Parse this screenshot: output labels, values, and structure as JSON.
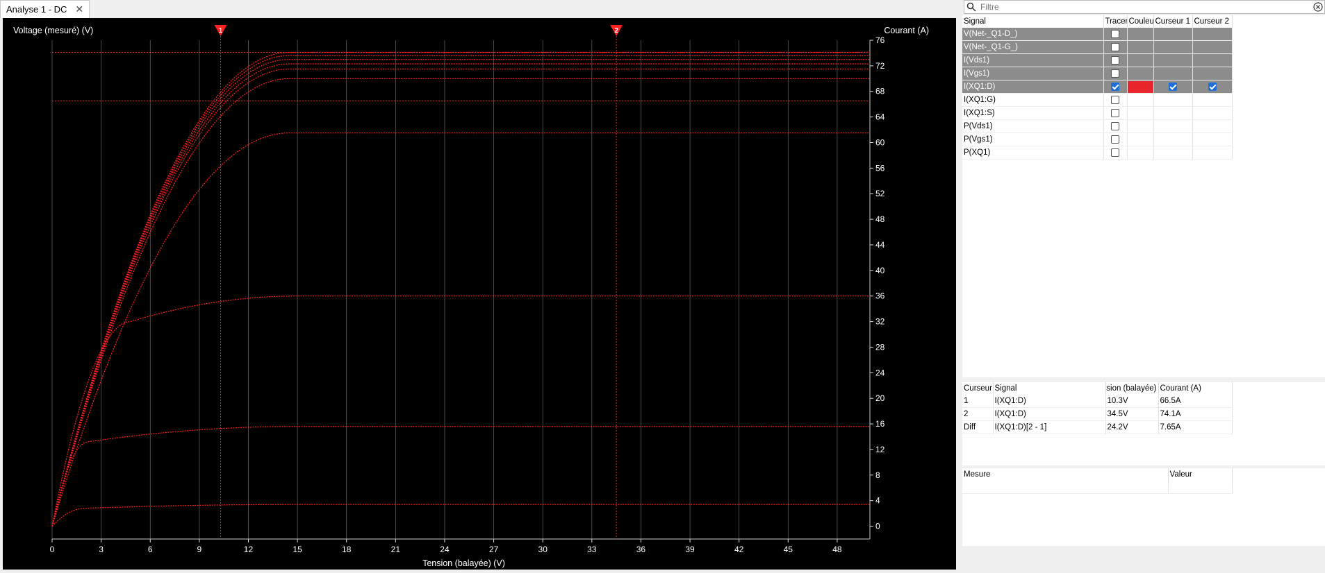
{
  "tab": {
    "title": "Analyse 1 - DC",
    "close": "✕"
  },
  "filter": {
    "placeholder": "Filtre"
  },
  "chart_data": {
    "type": "line",
    "xlabel": "Tension (balayée) (V)",
    "ylabel_left": "Voltage (mesuré) (V)",
    "ylabel_right": "Courant (A)",
    "xlim": [
      0,
      50
    ],
    "ylim": [
      -2,
      76
    ],
    "xticks": [
      0,
      3,
      6,
      9,
      12,
      15,
      18,
      21,
      24,
      27,
      30,
      33,
      36,
      39,
      42,
      45,
      48
    ],
    "yticks": [
      0,
      4,
      8,
      12,
      16,
      20,
      24,
      28,
      32,
      36,
      40,
      44,
      48,
      52,
      56,
      60,
      64,
      68,
      72,
      76
    ],
    "grid": true,
    "series_color": "#ff2020",
    "series": [
      {
        "sat_v": 2.0,
        "plateau": [
          2.8,
          3.4
        ]
      },
      {
        "sat_v": 2.2,
        "plateau": [
          13.2,
          15.6
        ]
      },
      {
        "sat_v": 4.8,
        "plateau": [
          32.0,
          36.0
        ]
      },
      {
        "sat_v": 14.5,
        "plateau": [
          61.5,
          61.5
        ]
      },
      {
        "sat_v": 14.5,
        "plateau": [
          70.0,
          70.0
        ]
      },
      {
        "sat_v": 14.5,
        "plateau": [
          71.5,
          71.5
        ]
      },
      {
        "sat_v": 14.5,
        "plateau": [
          72.3,
          72.3
        ]
      },
      {
        "sat_v": 14.5,
        "plateau": [
          73.0,
          73.0
        ]
      },
      {
        "sat_v": 14.5,
        "plateau": [
          73.6,
          73.6
        ]
      },
      {
        "sat_v": 14.5,
        "plateau": [
          74.1,
          74.1
        ]
      }
    ],
    "cursors": [
      {
        "label": "1",
        "x": 10.3,
        "y": 66.5
      },
      {
        "label": "2",
        "x": 34.5,
        "y": 74.1
      }
    ]
  },
  "signals": {
    "headers": [
      "Signal",
      "Tracer",
      "Couleur",
      "Curseur 1",
      "Curseur 2"
    ],
    "rows": [
      {
        "name": "V(Net-_Q1-D_)",
        "trace": false,
        "color": "",
        "c1": null,
        "c2": null,
        "sel": true
      },
      {
        "name": "V(Net-_Q1-G_)",
        "trace": false,
        "color": "",
        "c1": null,
        "c2": null,
        "sel": true
      },
      {
        "name": "I(Vds1)",
        "trace": false,
        "color": "",
        "c1": null,
        "c2": null,
        "sel": true
      },
      {
        "name": "I(Vgs1)",
        "trace": false,
        "color": "",
        "c1": null,
        "c2": null,
        "sel": true
      },
      {
        "name": "I(XQ1:D)",
        "trace": true,
        "color": "#e8262c",
        "c1": true,
        "c2": true,
        "sel": true
      },
      {
        "name": "I(XQ1:G)",
        "trace": false,
        "color": "",
        "c1": null,
        "c2": null,
        "sel": false
      },
      {
        "name": "I(XQ1:S)",
        "trace": false,
        "color": "",
        "c1": null,
        "c2": null,
        "sel": false
      },
      {
        "name": "P(Vds1)",
        "trace": false,
        "color": "",
        "c1": null,
        "c2": null,
        "sel": false
      },
      {
        "name": "P(Vgs1)",
        "trace": false,
        "color": "",
        "c1": null,
        "c2": null,
        "sel": false
      },
      {
        "name": "P(XQ1)",
        "trace": false,
        "color": "",
        "c1": null,
        "c2": null,
        "sel": false
      }
    ]
  },
  "cursor_table": {
    "headers": [
      "Curseur",
      "Signal",
      "Tension (balayée) (",
      "Courant (A)"
    ],
    "rows": [
      [
        "1",
        "I(XQ1:D)",
        "10.3V",
        "66.5A"
      ],
      [
        "2",
        "I(XQ1:D)",
        "34.5V",
        "74.1A"
      ],
      [
        "Diff",
        "I(XQ1:D)[2 - 1]",
        "24.2V",
        "7.65A"
      ]
    ]
  },
  "measure_table": {
    "headers": [
      "Mesure",
      "Valeur"
    ]
  }
}
